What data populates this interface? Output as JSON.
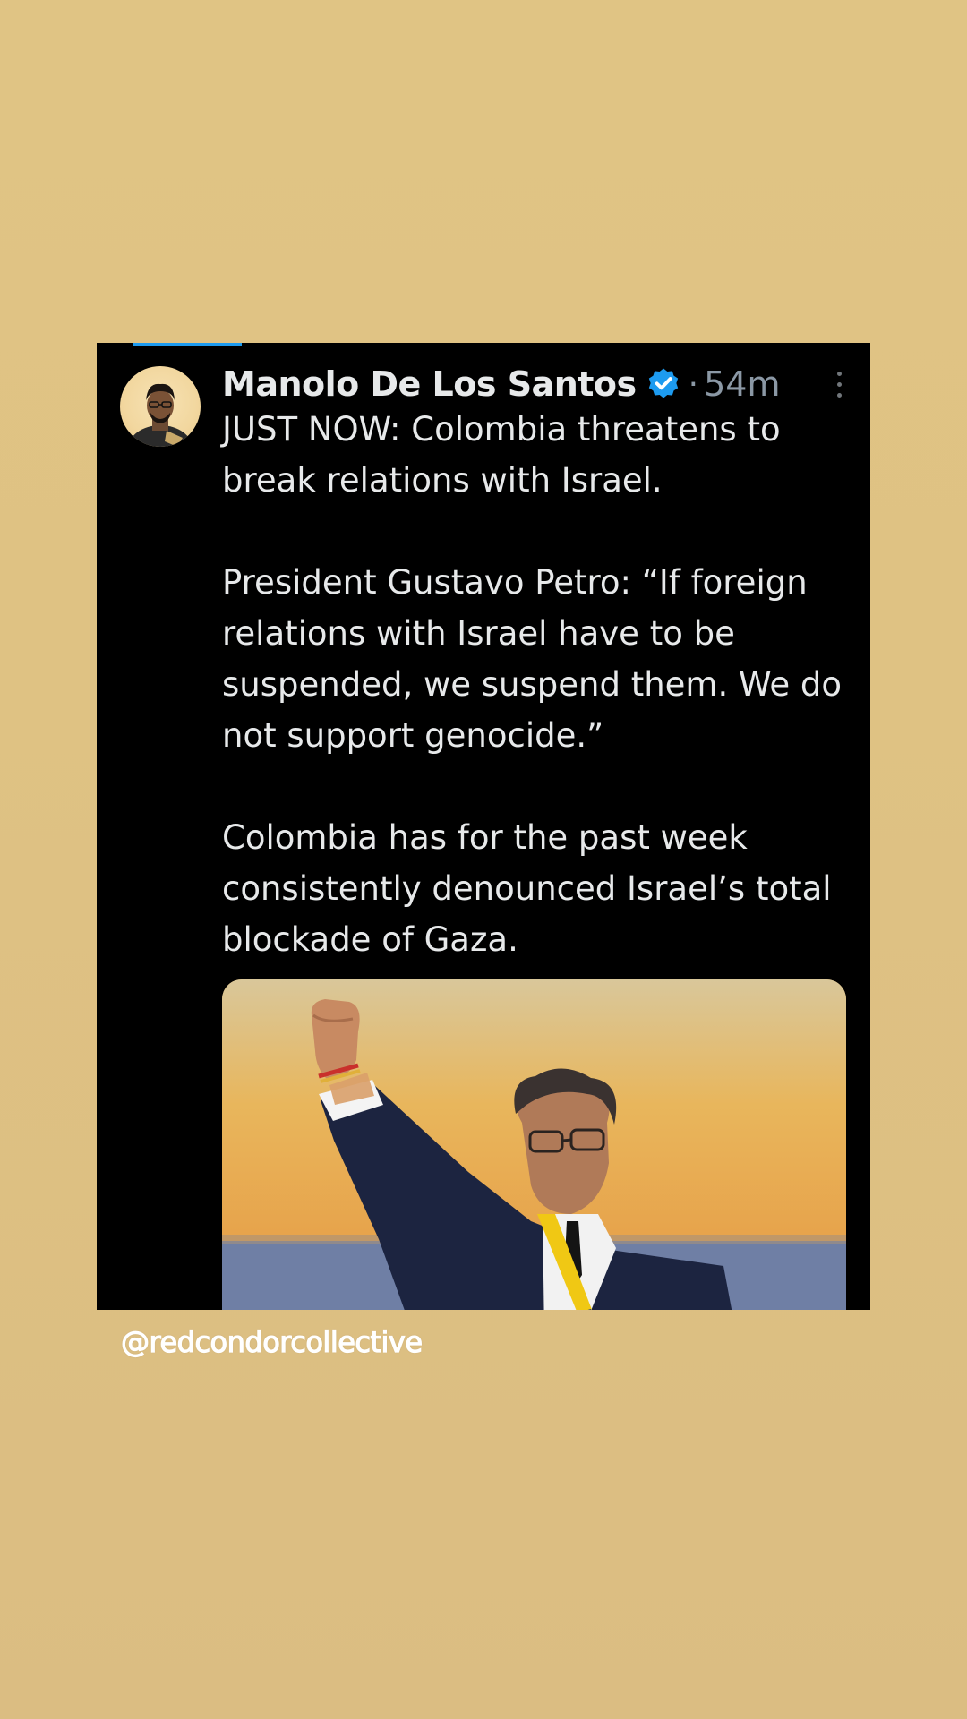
{
  "tweet": {
    "author_name": "Manolo De Los Santos",
    "separator": "·",
    "timestamp": "54m",
    "paragraphs": [
      "JUST NOW: Colombia threatens to break relations with Israel.",
      "President Gustavo Petro: “If foreign relations with Israel have to be suspended, we suspend them. We do not support genocide.”",
      "Colombia has for the past week consistently denounced Israel’s total blockade of Gaza."
    ],
    "verified_icon": "verified-badge-icon",
    "more_icon": "more-options-icon",
    "verified_color": "#1d9bf0"
  },
  "story": {
    "watermark": "@redcondorcollective",
    "background_color": "#dfc283"
  }
}
